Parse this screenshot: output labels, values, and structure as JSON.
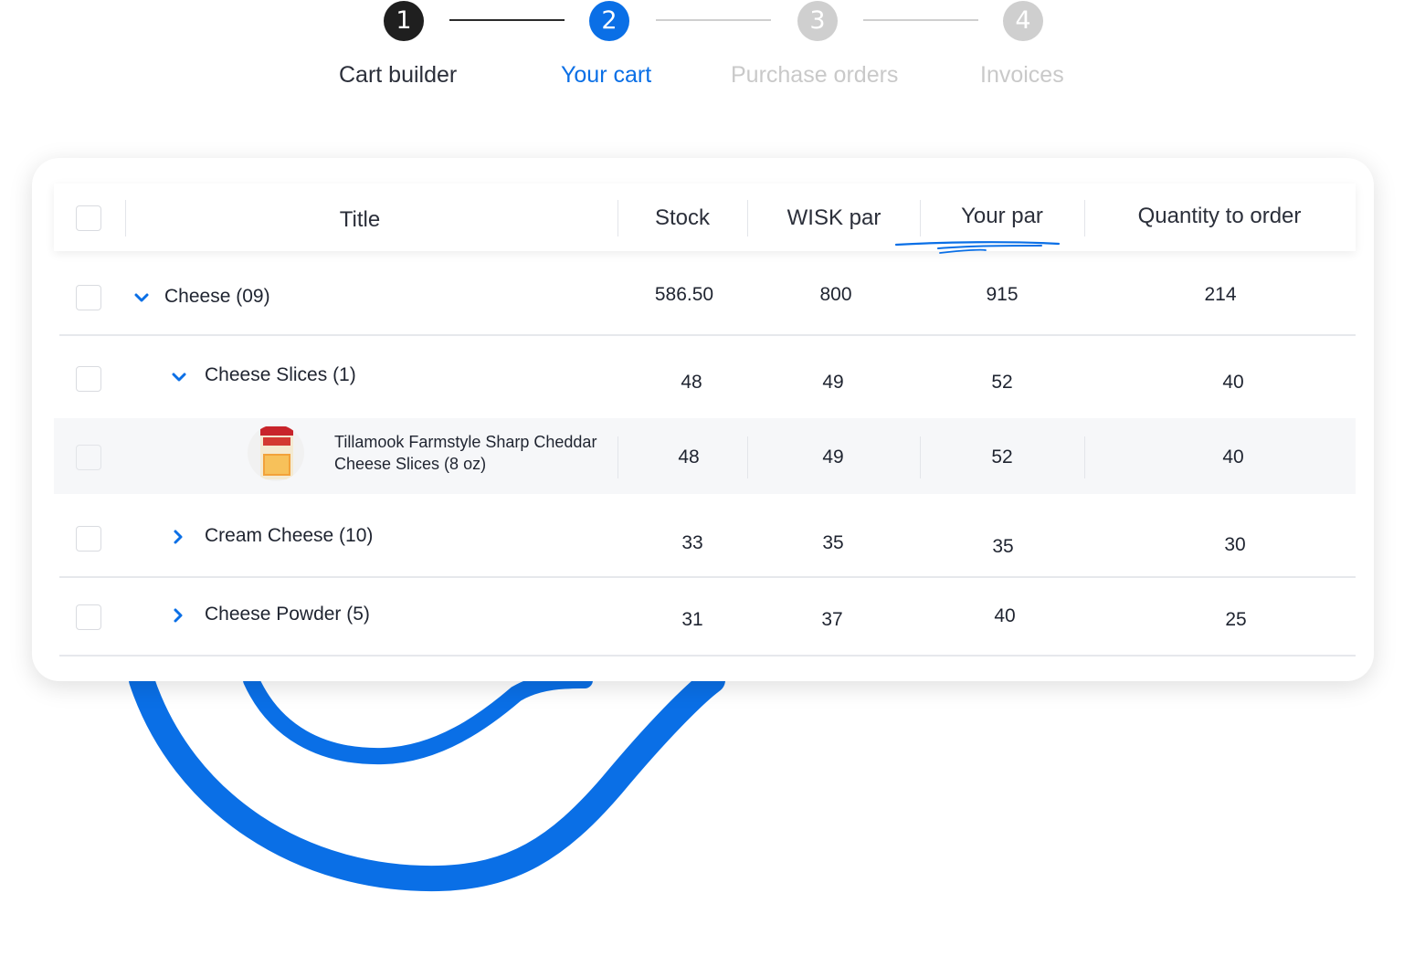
{
  "stepper": {
    "steps": [
      {
        "num": "1",
        "label": "Cart builder"
      },
      {
        "num": "2",
        "label": "Your cart"
      },
      {
        "num": "3",
        "label": "Purchase orders"
      },
      {
        "num": "4",
        "label": "Invoices"
      }
    ],
    "colors": {
      "done": "#1f1f1f",
      "active": "#0A6FE6",
      "pending": "#cfcfcf"
    }
  },
  "table": {
    "columns": [
      "Title",
      "Stock",
      "WISK par",
      "Your par",
      "Quantity to order"
    ],
    "rows": [
      {
        "title": "Cheese (09)",
        "stock": "586.50",
        "wisk_par": "800",
        "your_par": "915",
        "qty": "214"
      },
      {
        "title": "Cheese Slices (1)",
        "stock": "48",
        "wisk_par": "49",
        "your_par": "52",
        "qty": "40"
      },
      {
        "title": "Tillamook Farmstyle Sharp Cheddar Cheese Slices (8 oz)",
        "stock": "48",
        "wisk_par": "49",
        "your_par": "52",
        "qty": "40"
      },
      {
        "title": "Cream Cheese (10)",
        "stock": "33",
        "wisk_par": "35",
        "your_par": "35",
        "qty": "30"
      },
      {
        "title": "Cheese Powder (5)",
        "stock": "31",
        "wisk_par": "37",
        "your_par": "40",
        "qty": "25"
      }
    ],
    "product_image": {
      "brand": "Tillamook"
    }
  },
  "colors": {
    "accent": "#0A6FE6",
    "text": "#1f2430",
    "muted": "#c9c9c9"
  },
  "icons": {
    "expanded": "chevron-down-icon",
    "collapsed": "chevron-right-icon"
  }
}
